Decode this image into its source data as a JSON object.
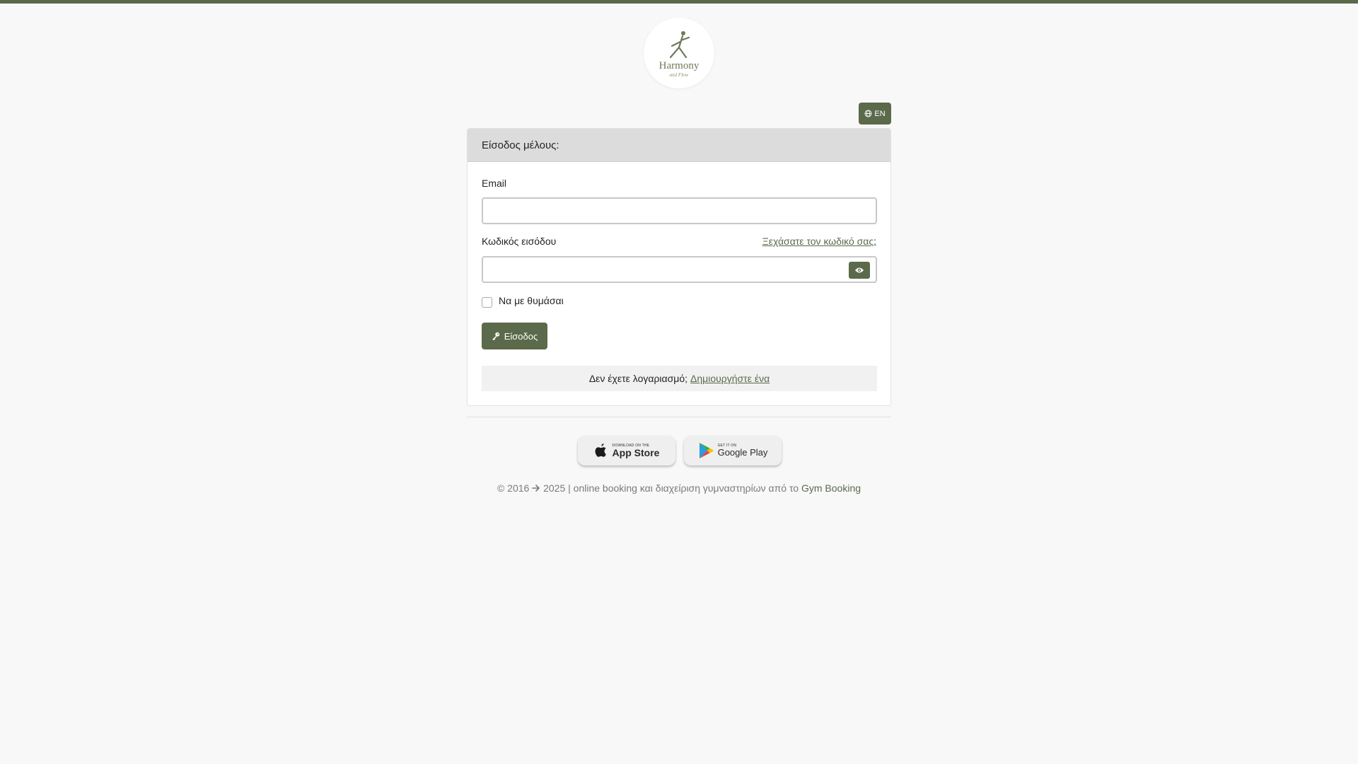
{
  "brand": {
    "logo_name": "Harmony",
    "logo_sub": "and Flow",
    "accent": "#5b6a4a"
  },
  "lang": {
    "label": "EN"
  },
  "login": {
    "header": "Είσοδος μέλους:",
    "email_label": "Email",
    "password_label": "Κωδικός εισόδου",
    "forgot_link": "Ξεχάσατε τον κωδικό σας",
    "forgot_suffix": ";",
    "remember_label": "Να με θυμάσαι",
    "submit_label": "Είσοδος",
    "no_account_text": "Δεν έχετε λογαριασμό;",
    "register_link": "Δημιουργήστε ένα"
  },
  "stores": {
    "apple_small": "Download on the",
    "apple_big": "App Store",
    "google_small": "GET IT ON",
    "google_big": "Google Play"
  },
  "footer": {
    "year_start": "© 2016",
    "year_end": "2025 | online booking και διαχείριση γυμναστηρίων από το",
    "brand_link": "Gym Booking"
  }
}
